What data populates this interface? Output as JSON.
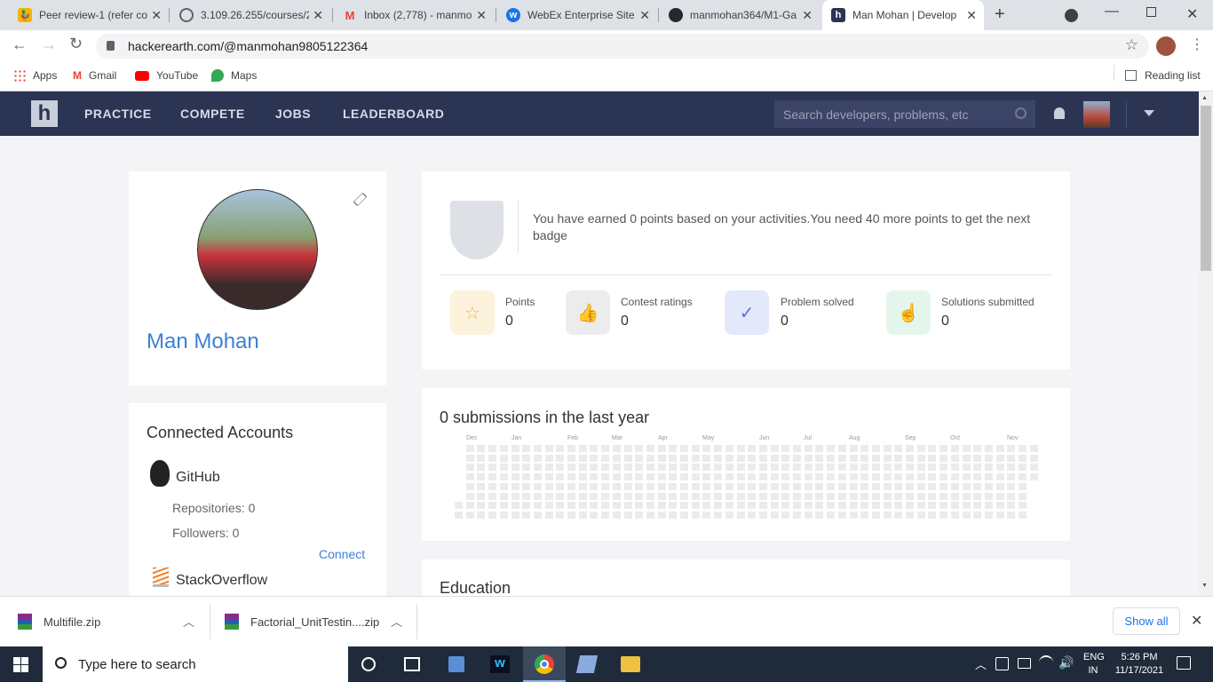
{
  "browser": {
    "tabs": [
      {
        "title": "Peer review-1 (refer co",
        "favicon": "duck-icon",
        "color": "#f5b400"
      },
      {
        "title": "3.109.26.255/courses/2",
        "favicon": "globe-icon",
        "color": "#5f6368"
      },
      {
        "title": "Inbox (2,778) - manmo",
        "favicon": "gmail-icon",
        "color": "#ea4335"
      },
      {
        "title": "WebEx Enterprise Site",
        "favicon": "webex-icon",
        "color": "#1a73e8"
      },
      {
        "title": "manmohan364/M1-Ga",
        "favicon": "github-icon",
        "color": "#24292e"
      },
      {
        "title": "Man Mohan | Develop",
        "favicon": "hackerearth-icon",
        "color": "#2c3454"
      }
    ],
    "url": "hackerearth.com/@manmohan9805122364",
    "bookmarks": [
      "Apps",
      "Gmail",
      "YouTube",
      "Maps"
    ],
    "reading_list": "Reading list"
  },
  "site": {
    "logo": "h",
    "nav": [
      "PRACTICE",
      "COMPETE",
      "JOBS",
      "LEADERBOARD"
    ],
    "search_placeholder": "Search developers, problems, etc"
  },
  "profile": {
    "name": "Man Mohan"
  },
  "badge": {
    "message": "You have earned 0 points based on your activities.You need 40 more points to get the next badge"
  },
  "stats": [
    {
      "label": "Points",
      "value": "0",
      "icon": "star-icon",
      "bg": "#fdf3dc",
      "fg": "#f0b43c"
    },
    {
      "label": "Contest ratings",
      "value": "0",
      "icon": "thumbs-up-icon",
      "bg": "#ececec",
      "fg": "#999999"
    },
    {
      "label": "Problem solved",
      "value": "0",
      "icon": "check-circle-icon",
      "bg": "#e4e8fb",
      "fg": "#5a72d8"
    },
    {
      "label": "Solutions submitted",
      "value": "0",
      "icon": "pointer-hand-icon",
      "bg": "#e4f6ec",
      "fg": "#3cb878"
    }
  ],
  "submissions": {
    "title": "0 submissions in the last year",
    "months": [
      "Dec",
      "Jan",
      "Feb",
      "Mar",
      "Apr",
      "May",
      "Jun",
      "Jul",
      "Aug",
      "Sep",
      "Oct",
      "Nov"
    ]
  },
  "connected": {
    "title": "Connected Accounts",
    "github": {
      "name": "GitHub",
      "repos": "Repositories: 0",
      "followers": "Followers: 0",
      "connect": "Connect"
    },
    "stackoverflow": {
      "name": "StackOverflow"
    }
  },
  "education": {
    "title": "Education"
  },
  "downloads": {
    "items": [
      "Multifile.zip",
      "Factorial_UnitTestin....zip"
    ],
    "show_all": "Show all"
  },
  "taskbar": {
    "search_placeholder": "Type here to search",
    "lang": "ENG",
    "region": "IN",
    "time": "5:26 PM",
    "date": "11/17/2021"
  }
}
